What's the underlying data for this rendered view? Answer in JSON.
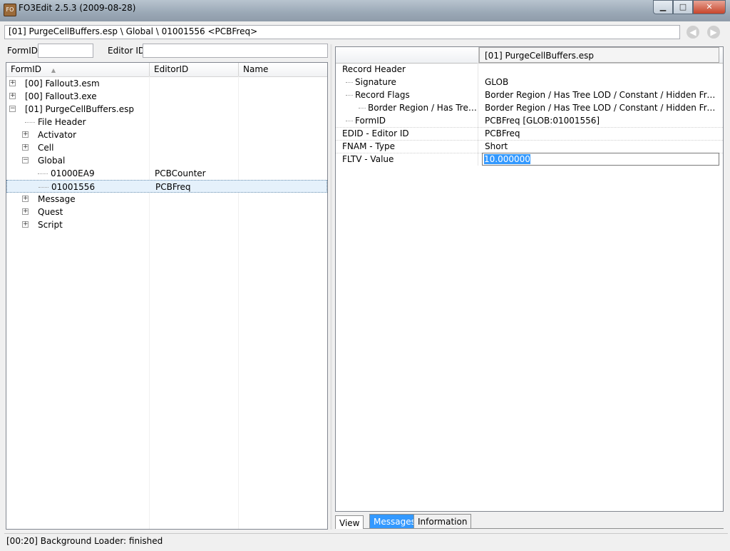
{
  "window": {
    "title": "FO3Edit 2.5.3 (2009-08-28)",
    "app_icon": "fo3edit-app-icon",
    "minimize": "▁",
    "maximize": "□",
    "close": "✕"
  },
  "pathbar": {
    "path": "[01] PurgeCellBuffers.esp \\ Global \\ 01001556 <PCBFreq>",
    "back_icon": "back-arrow-icon",
    "forward_icon": "forward-arrow-icon"
  },
  "filters": {
    "formid_label": "FormID",
    "formid_value": "",
    "editorid_label": "Editor ID",
    "editorid_value": ""
  },
  "tree": {
    "columns": [
      "FormID",
      "EditorID",
      "Name"
    ],
    "sort_indicator": "▲",
    "rows": [
      {
        "label": "[00] Fallout3.esm",
        "editor_id": "",
        "expander": "+"
      },
      {
        "label": "[00] Fallout3.exe",
        "editor_id": "",
        "expander": "+"
      },
      {
        "label": "[01] PurgeCellBuffers.esp",
        "editor_id": "",
        "expander": "−"
      },
      {
        "label": "File Header",
        "editor_id": "",
        "expander": ""
      },
      {
        "label": "Activator",
        "editor_id": "",
        "expander": "+"
      },
      {
        "label": "Cell",
        "editor_id": "",
        "expander": "+"
      },
      {
        "label": "Global",
        "editor_id": "",
        "expander": "−"
      },
      {
        "label": "01000EA9",
        "editor_id": "PCBCounter",
        "expander": ""
      },
      {
        "label": "01001556",
        "editor_id": "PCBFreq",
        "expander": ""
      },
      {
        "label": "Message",
        "editor_id": "",
        "expander": "+"
      },
      {
        "label": "Quest",
        "editor_id": "",
        "expander": "+"
      },
      {
        "label": "Script",
        "editor_id": "",
        "expander": "+"
      }
    ]
  },
  "record": {
    "column_header": "[01] PurgeCellBuffers.esp",
    "rows": [
      {
        "key": "Record Header",
        "value": ""
      },
      {
        "key": "Signature",
        "value": "GLOB"
      },
      {
        "key": "Record Flags",
        "value": "Border Region / Has Tree LOD / Constant / Hidden From Lo..."
      },
      {
        "key": "Border Region / Has Tree L...",
        "value": "Border Region / Has Tree LOD / Constant / Hidden From Lo..."
      },
      {
        "key": "FormID",
        "value": "PCBFreq [GLOB:01001556]"
      },
      {
        "key": "EDID - Editor ID",
        "value": "PCBFreq"
      },
      {
        "key": "FNAM - Type",
        "value": "Short"
      },
      {
        "key": "FLTV - Value",
        "value": "10.000000"
      }
    ]
  },
  "tabs": {
    "view": "View",
    "messages": "Messages",
    "information": "Information"
  },
  "status": {
    "text": "[00:20] Background Loader: finished"
  }
}
